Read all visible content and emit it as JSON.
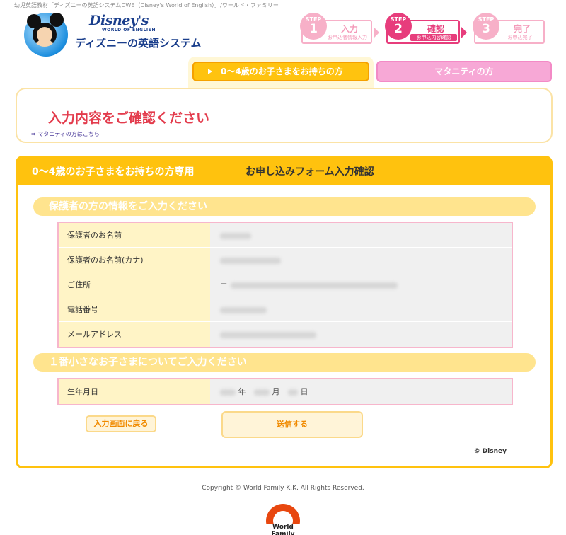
{
  "header": {
    "top_note": "幼児英語教材「ディズニーの英語システムDWE（Disney's World of English）」/ワールド・ファミリー",
    "logo_brand": "Disney's",
    "logo_sub": "WORLD OF ENGLISH",
    "logo_title": "ディズニーの英語システム"
  },
  "steps": [
    {
      "label": "STEP",
      "number": "1",
      "name": "入力",
      "desc": "お申込者情報入力",
      "active": false
    },
    {
      "label": "STEP",
      "number": "2",
      "name": "確認",
      "desc": "お申込内容確認",
      "active": true
    },
    {
      "label": "STEP",
      "number": "3",
      "name": "完了",
      "desc": "お申込完了",
      "active": false
    }
  ],
  "tabs": {
    "main": "0～4歳のお子さまをお持ちの方",
    "maternity": "マタニティの方"
  },
  "confirm": {
    "title": "入力内容をご確認ください",
    "maternity_link": "⇒ マタニティの方はこちら"
  },
  "form": {
    "header_label": "0～4歳のお子さまをお持ちの方専用",
    "header_title": "お申し込みフォーム入力確認",
    "guardian_section": "保護者の方の情報をご入力ください",
    "guardian_rows": [
      {
        "label": "保護者のお名前",
        "value": ""
      },
      {
        "label": "保護者のお名前(カナ)",
        "value": ""
      },
      {
        "label": "ご住所",
        "value": "〒"
      },
      {
        "label": "電話番号",
        "value": ""
      },
      {
        "label": "メールアドレス",
        "value": ""
      }
    ],
    "child_section": "１番小さなお子さまについてご入力ください",
    "child_rows": [
      {
        "label": "生年月日",
        "year": "年",
        "month": "月",
        "day": "日"
      }
    ],
    "back_button": "入力画面に戻る",
    "send_button": "送信する",
    "disney_copy": "© Disney"
  },
  "footer": {
    "copyright": "Copyright © World Family K.K. All Rights Reserved.",
    "logo_text": "World Family"
  },
  "colors": {
    "accent_yellow": "#ffc20e",
    "accent_pink": "#e73d7c",
    "title_red": "#e33b4c",
    "brand_blue": "#1a3e8c"
  }
}
